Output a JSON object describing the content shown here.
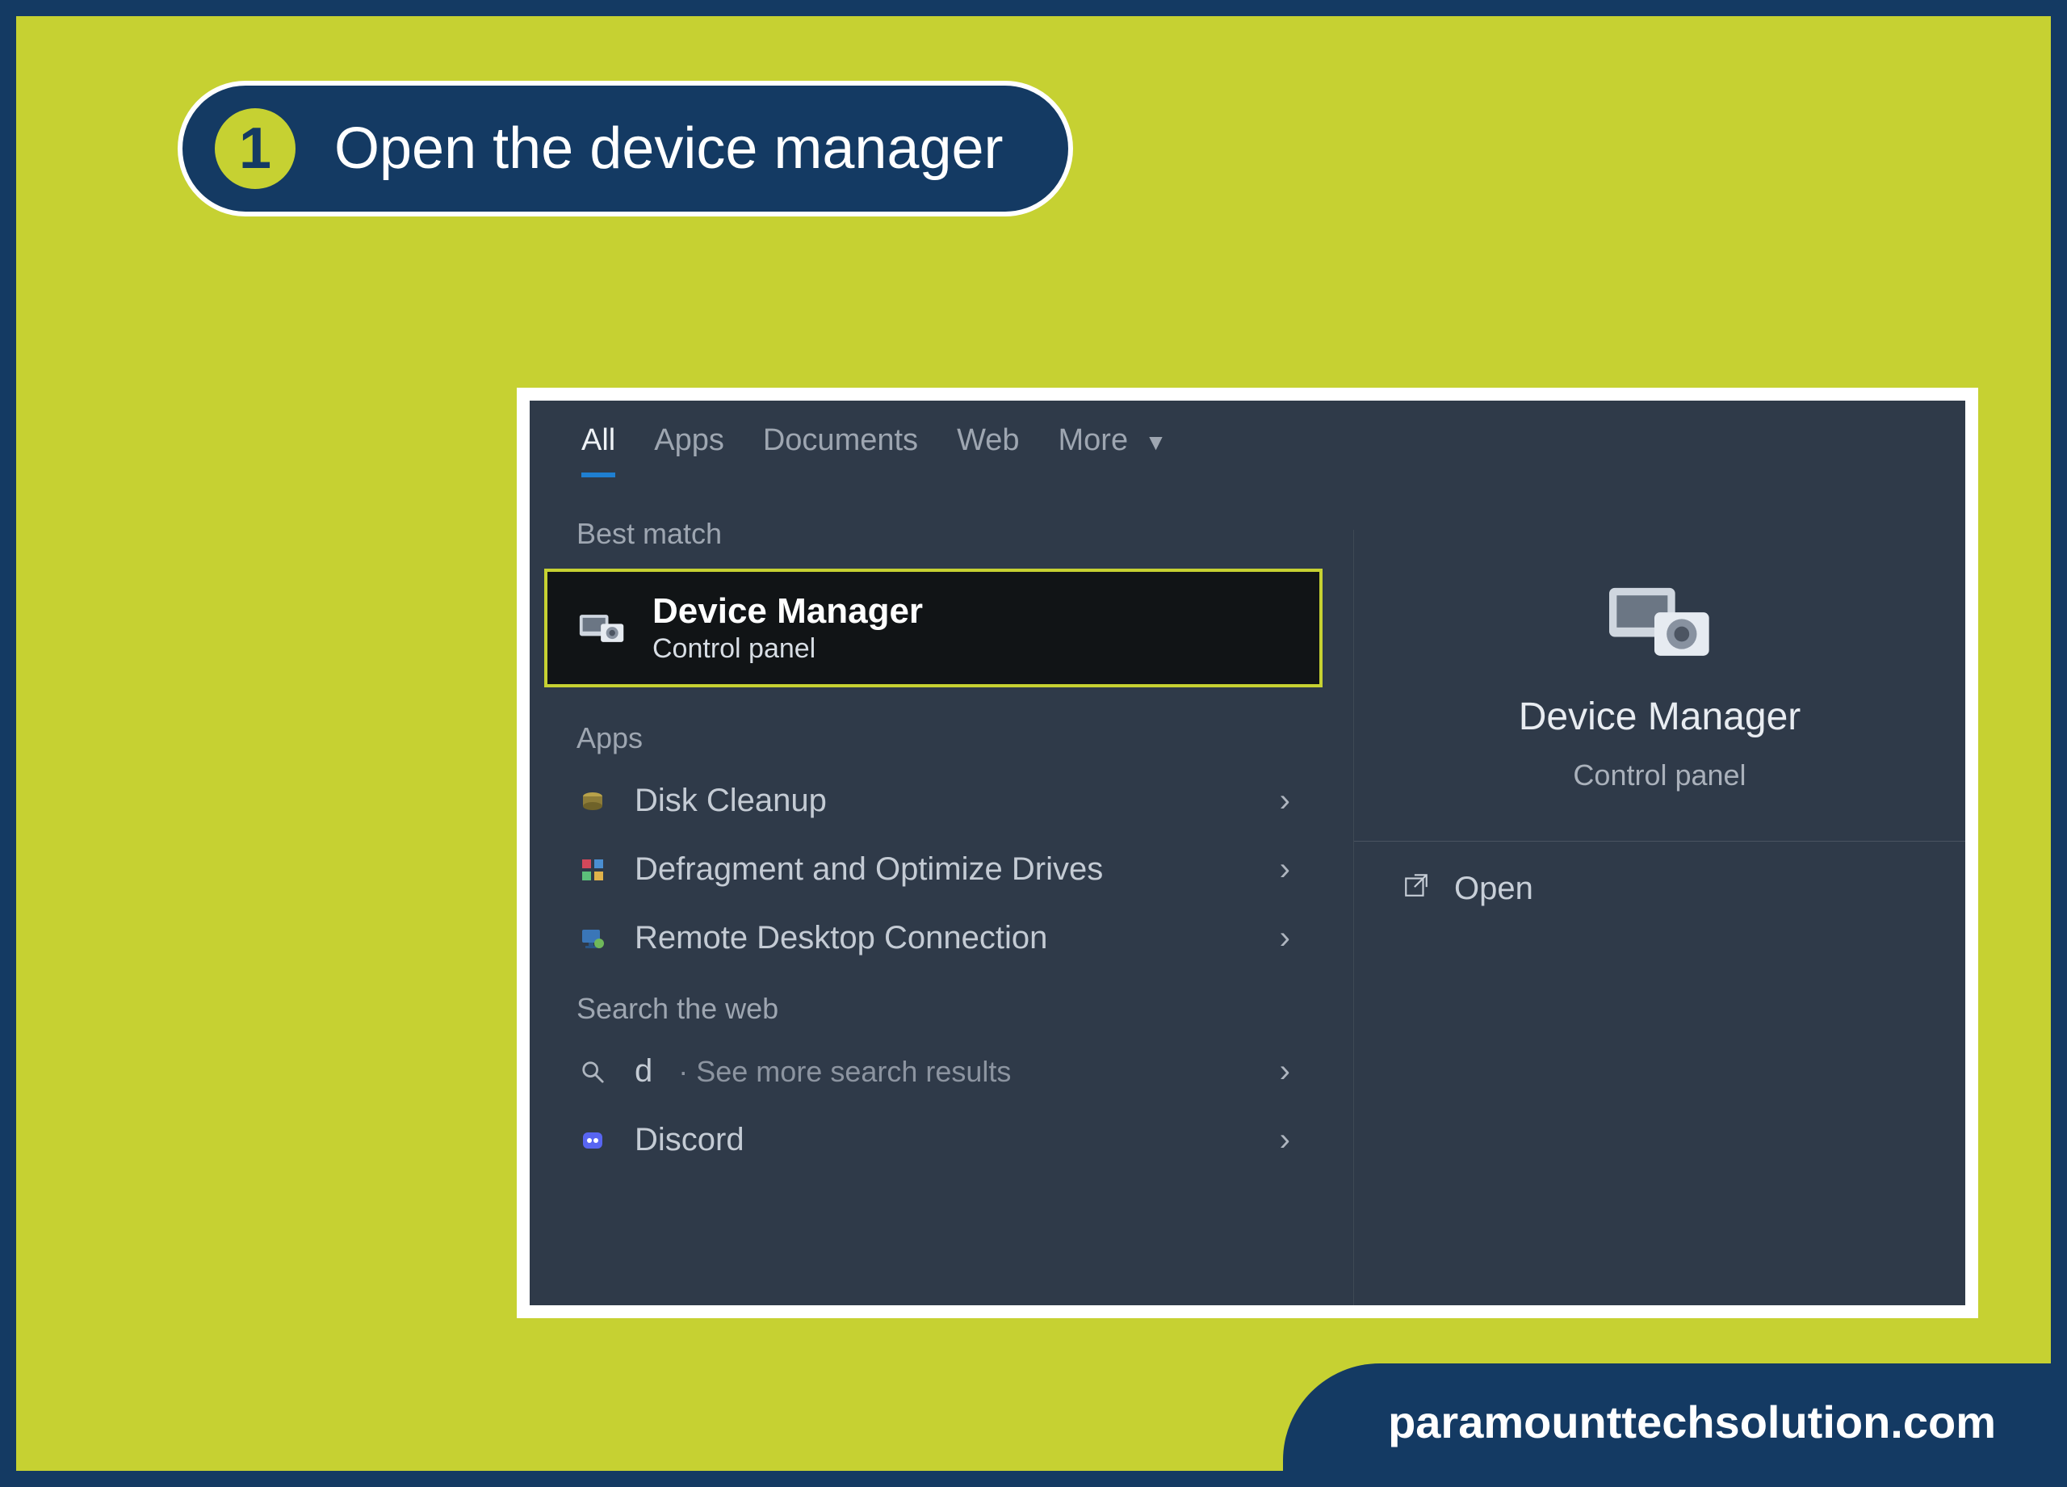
{
  "step": {
    "number": "1",
    "title": "Open the device manager"
  },
  "searchWindow": {
    "tabs": [
      "All",
      "Apps",
      "Documents",
      "Web",
      "More"
    ],
    "activeTab": 0,
    "sections": {
      "bestMatchLabel": "Best match",
      "appsLabel": "Apps",
      "webLabel": "Search the web"
    },
    "bestMatch": {
      "title": "Device Manager",
      "subtitle": "Control panel",
      "icon": "device-manager-icon"
    },
    "apps": [
      {
        "label": "Disk Cleanup",
        "icon": "disk-cleanup-icon"
      },
      {
        "label": "Defragment and Optimize Drives",
        "icon": "defrag-icon"
      },
      {
        "label": "Remote Desktop Connection",
        "icon": "remote-desktop-icon"
      }
    ],
    "webResults": [
      {
        "query": "d",
        "hint": "See more search results",
        "icon": "search-icon"
      },
      {
        "label": "Discord",
        "icon": "discord-icon"
      }
    ],
    "preview": {
      "title": "Device Manager",
      "subtitle": "Control panel",
      "icon": "device-manager-icon",
      "actions": [
        {
          "label": "Open",
          "icon": "open-icon"
        }
      ]
    }
  },
  "footer": {
    "site": "paramounttechsolution.com"
  }
}
